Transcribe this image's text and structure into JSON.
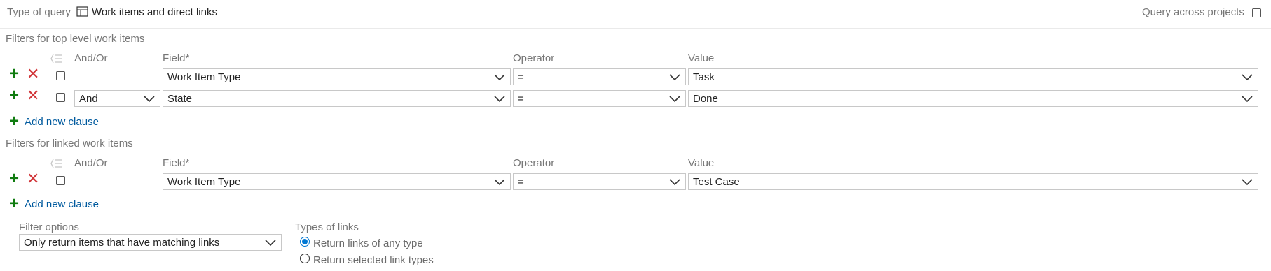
{
  "header": {
    "type_of_query_label": "Type of query",
    "type_of_query_value": "Work items and direct links",
    "query_across_projects_label": "Query across projects"
  },
  "top_filters": {
    "section_title": "Filters for top level work items",
    "columns": {
      "andor": "And/Or",
      "field": "Field*",
      "operator": "Operator",
      "value": "Value"
    },
    "rows": [
      {
        "andor": "",
        "field": "Work Item Type",
        "operator": "=",
        "value": "Task"
      },
      {
        "andor": "And",
        "field": "State",
        "operator": "=",
        "value": "Done"
      }
    ],
    "add_clause": "Add new clause"
  },
  "linked_filters": {
    "section_title": "Filters for linked work items",
    "columns": {
      "andor": "And/Or",
      "field": "Field*",
      "operator": "Operator",
      "value": "Value"
    },
    "rows": [
      {
        "andor": "",
        "field": "Work Item Type",
        "operator": "=",
        "value": "Test Case"
      }
    ],
    "add_clause": "Add new clause"
  },
  "filter_options": {
    "label": "Filter options",
    "selected": "Only return items that have matching links"
  },
  "types_of_links": {
    "label": "Types of links",
    "options": [
      {
        "label": "Return links of any type",
        "selected": true
      },
      {
        "label": "Return selected link types",
        "selected": false
      }
    ]
  },
  "icons": {
    "add": "plus-icon",
    "remove": "x-icon",
    "group": "group-clauses-icon",
    "query_type": "table-icon"
  },
  "colors": {
    "add": "#107c10",
    "remove": "#d13438",
    "link": "#005a9e",
    "radio": "#0078d4"
  }
}
